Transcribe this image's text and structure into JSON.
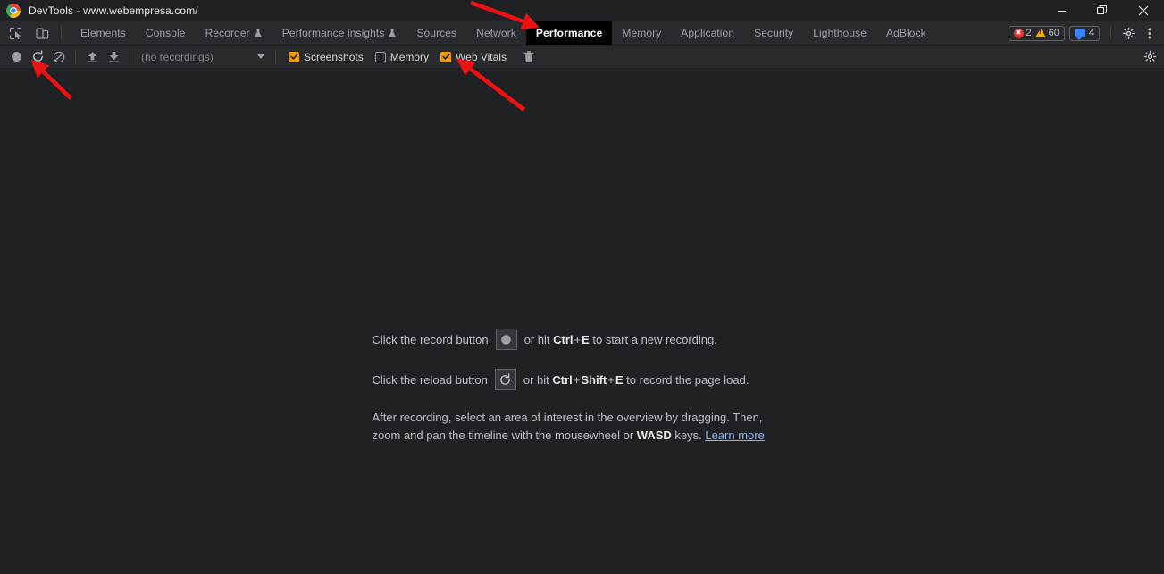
{
  "window": {
    "title": "DevTools - www.webempresa.com/",
    "logo_icon": "chrome-logo-icon",
    "controls": {
      "minimize": "minimize-icon",
      "restore": "restore-icon",
      "close": "close-icon"
    }
  },
  "tabbar": {
    "left_icons": [
      {
        "name": "inspect-element-icon"
      },
      {
        "name": "device-toolbar-icon"
      }
    ],
    "tabs": [
      {
        "label": "Elements",
        "active": false,
        "experimental": false
      },
      {
        "label": "Console",
        "active": false,
        "experimental": false
      },
      {
        "label": "Recorder",
        "active": false,
        "experimental": true
      },
      {
        "label": "Performance insights",
        "active": false,
        "experimental": true
      },
      {
        "label": "Sources",
        "active": false,
        "experimental": false
      },
      {
        "label": "Network",
        "active": false,
        "experimental": false
      },
      {
        "label": "Performance",
        "active": true,
        "experimental": false
      },
      {
        "label": "Memory",
        "active": false,
        "experimental": false
      },
      {
        "label": "Application",
        "active": false,
        "experimental": false
      },
      {
        "label": "Security",
        "active": false,
        "experimental": false
      },
      {
        "label": "Lighthouse",
        "active": false,
        "experimental": false
      },
      {
        "label": "AdBlock",
        "active": false,
        "experimental": false
      }
    ],
    "issues": {
      "errors": "2",
      "warnings": "60",
      "messages": "4",
      "error_icon": "error-circle-icon",
      "warning_icon": "warning-triangle-icon",
      "message_icon": "info-message-icon"
    },
    "settings_icon": "gear-icon",
    "more_icon": "kebab-menu-icon"
  },
  "panel_toolbar": {
    "record_icon": "record-circle-icon",
    "reload_icon": "reload-record-icon",
    "clear_icon": "clear-no-entry-icon",
    "upload_icon": "upload-profile-icon",
    "download_icon": "download-profile-icon",
    "recordings_value": "(no recordings)",
    "dropdown_icon": "chevron-down-icon",
    "checkboxes": [
      {
        "label": "Screenshots",
        "checked": true
      },
      {
        "label": "Memory",
        "checked": false
      },
      {
        "label": "Web Vitals",
        "checked": true
      }
    ],
    "trash_icon": "trash-icon",
    "settings_icon": "gear-icon"
  },
  "landing": {
    "record_line": {
      "prefix": "Click the record button",
      "mid": "or hit",
      "key1": "Ctrl",
      "plus": "+",
      "key2": "E",
      "suffix": "to start a new recording.",
      "button_icon": "record-circle-icon"
    },
    "reload_line": {
      "prefix": "Click the reload button",
      "mid": "or hit",
      "key1": "Ctrl",
      "plus": "+",
      "key2": "Shift",
      "plus2": "+",
      "key3": "E",
      "suffix": "to record the page load.",
      "button_icon": "reload-record-icon"
    },
    "hint": {
      "part1": "After recording, select an area of interest in the overview by dragging. Then, zoom and pan the timeline with the mousewheel or ",
      "keys": "WASD",
      "part2": " keys. ",
      "link": "Learn more"
    }
  },
  "annotations": {
    "arrow_color": "#ee1111",
    "arrows": [
      {
        "name": "arrow-to-performance-tab"
      },
      {
        "name": "arrow-to-reload-button"
      },
      {
        "name": "arrow-to-web-vitals-checkbox"
      }
    ]
  },
  "colors": {
    "panel_bg": "#202124",
    "toolbar_bg": "#292a2d",
    "active_tab_bg": "#000000",
    "accent_orange": "#f29900",
    "link_blue": "#8ab4f8",
    "error_red": "#e53935",
    "warning_yellow": "#f9ab00",
    "message_blue": "#3b82f6"
  }
}
